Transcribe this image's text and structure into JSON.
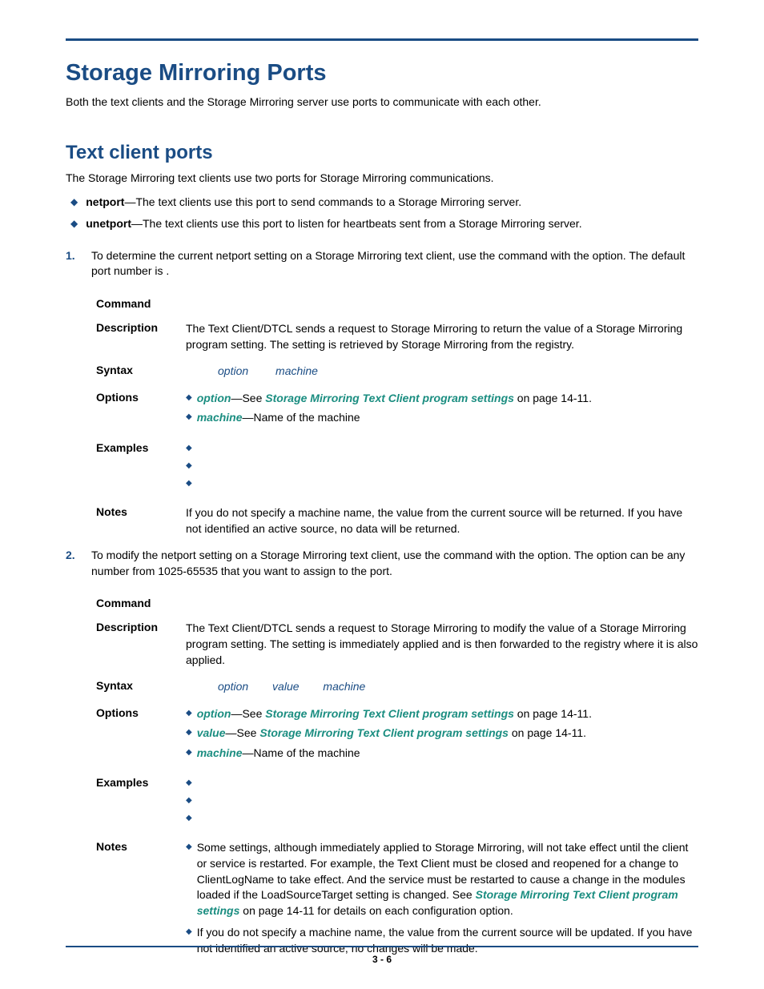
{
  "h1": "Storage Mirroring Ports",
  "intro": "Both the text clients and the Storage Mirroring server use ports to communicate with each other.",
  "h2": "Text client ports",
  "subintro": "The Storage Mirroring text clients use two ports for Storage Mirroring communications.",
  "bullets": [
    {
      "term": "netport",
      "rest": "—The text clients use this port to send commands to a Storage Mirroring server."
    },
    {
      "term": "unetport",
      "rest": "—The text clients use this port to listen for heartbeats sent from a Storage Mirroring server."
    }
  ],
  "step1": {
    "num": "1.",
    "text_a": "To determine the current netport setting on a Storage Mirroring text client, use the ",
    "text_b": " command with the ",
    "text_c": " option. The default port number is ",
    "text_d": "."
  },
  "labels": {
    "command": "Command",
    "description": "Description",
    "syntax": "Syntax",
    "options": "Options",
    "examples": "Examples",
    "notes": "Notes"
  },
  "table1": {
    "description": "The Text Client/DTCL sends a request to Storage Mirroring to return the value of a Storage Mirroring program setting. The setting is retrieved by Storage Mirroring from the registry.",
    "syntax_parts": [
      "option",
      "machine"
    ],
    "opt_option_a": "option",
    "opt_option_b": "—See ",
    "opt_option_link": "Storage Mirroring Text Client program settings",
    "opt_option_c": " on page 14-11.",
    "opt_machine_a": "machine",
    "opt_machine_b": "—Name of the machine",
    "notes": "If you do not specify a machine name, the value from the current source will be returned. If you have not identified an active source, no data will be returned."
  },
  "step2": {
    "num": "2.",
    "text_a": "To modify the netport setting on a Storage Mirroring text client, use the ",
    "text_b": " command with the ",
    "text_c": " option. The ",
    "text_d": " option can be any number from 1025-65535 that you want to assign to the port."
  },
  "table2": {
    "description": "The Text Client/DTCL sends a request to Storage Mirroring to modify  the value of a Storage Mirroring program setting. The setting is immediately applied and is then forwarded to the registry where it is also applied.",
    "syntax_parts": [
      "option",
      "value",
      "machine"
    ],
    "opt_option_a": "option",
    "opt_option_b": "—See ",
    "opt_option_link": "Storage Mirroring Text Client program settings",
    "opt_option_c": " on page 14-11.",
    "opt_value_a": "value",
    "opt_value_b": "—See ",
    "opt_value_link": "Storage Mirroring Text Client program settings",
    "opt_value_c": " on page 14-11.",
    "opt_machine_a": "machine",
    "opt_machine_b": "—Name of the machine",
    "note1_a": "Some settings, although immediately applied to Storage Mirroring, will not take effect until the client or service is restarted. For example, the Text Client must be closed and reopened for a change to ClientLogName to take effect. And the service must be restarted to cause a change in the modules loaded if the LoadSourceTarget setting is changed.  See ",
    "note1_link": "Storage Mirroring Text Client program settings",
    "note1_b": " on page 14-11 for details on each configuration option.",
    "note2": "If you do not specify a machine name, the value from the current source will be updated. If you have not identified an active source, no changes will be made."
  },
  "pagenum": "3 - 6"
}
